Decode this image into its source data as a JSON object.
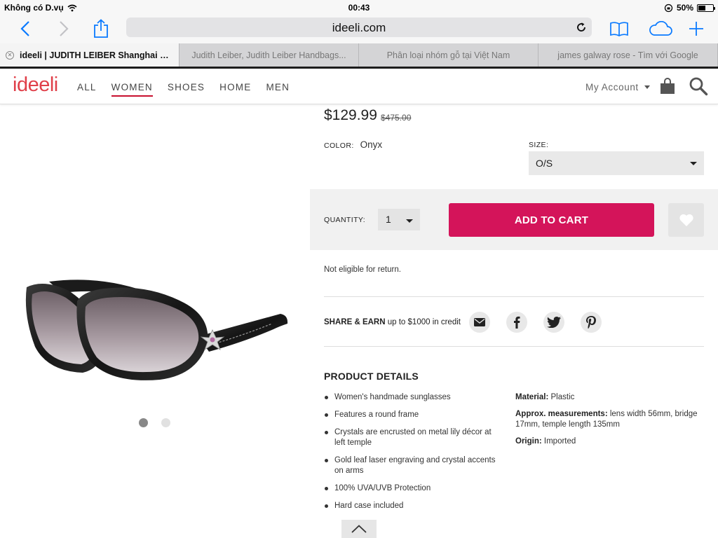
{
  "status_bar": {
    "carrier": "Không có D.vụ",
    "time": "00:43",
    "battery": "50%",
    "battery_level": 0.5
  },
  "browser": {
    "url": "ideeli.com",
    "tabs": [
      {
        "title": "ideeli | JUDITH LEIBER Shanghai Lil..."
      },
      {
        "title": "Judith Leiber, Judith Leiber Handbags..."
      },
      {
        "title": "Phân loại nhóm gỗ tại Việt Nam"
      },
      {
        "title": "james galway rose - Tìm với Google"
      }
    ],
    "icons": [
      "back-icon",
      "forward-icon",
      "share-icon",
      "bookmarks-icon",
      "icloud-tabs-icon",
      "new-tab-icon",
      "reload-icon"
    ]
  },
  "site": {
    "logo": "ideeli",
    "brand_color": "#e0404a",
    "nav": [
      "ALL",
      "WOMEN",
      "SHOES",
      "HOME",
      "MEN"
    ],
    "nav_active": "WOMEN",
    "account": "My Account"
  },
  "product": {
    "price": "$129.99",
    "old_price": "$475.00",
    "color_label": "COLOR:",
    "color_value": "Onyx",
    "size_label": "SIZE:",
    "size_value": "O/S",
    "quantity_label": "QUANTITY:",
    "quantity_value": "1",
    "add_to_cart": "ADD TO CART",
    "cart_color": "#d4145a",
    "return_note": "Not eligible for return.",
    "image_count": 2,
    "image_active": 1
  },
  "share": {
    "bold": "SHARE & EARN",
    "text": "up to $1000 in credit",
    "icons": [
      "email-icon",
      "facebook-icon",
      "twitter-icon",
      "pinterest-icon"
    ]
  },
  "details": {
    "title": "PRODUCT DETAILS",
    "bullets": [
      "Women's handmade sunglasses",
      "Features a round frame",
      "Crystals are encrusted on metal lily décor at left temple",
      "Gold leaf laser engraving and crystal accents on arms",
      "100% UVA/UVB Protection",
      "Hard case included"
    ],
    "material_label": "Material:",
    "material_value": "Plastic",
    "measurements_label": "Approx. measurements:",
    "measurements_value": "lens width 56mm, bridge 17mm, temple length 135mm",
    "origin_label": "Origin:",
    "origin_value": "Imported"
  }
}
